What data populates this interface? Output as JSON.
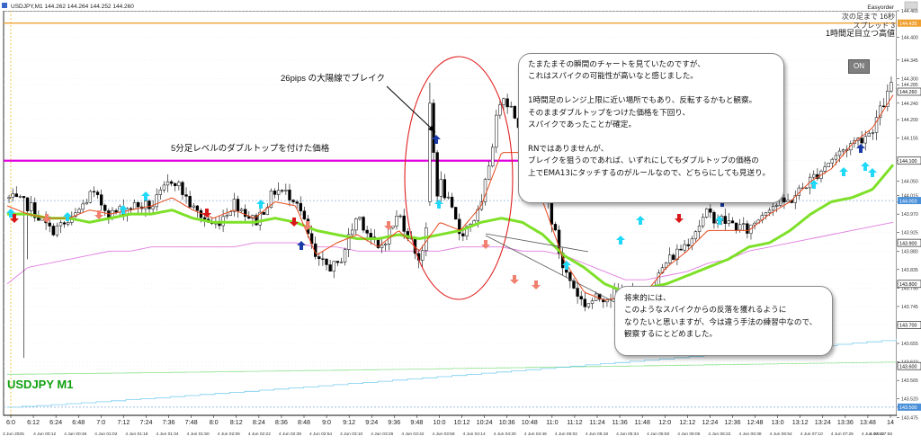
{
  "header": {
    "symbol_info": "USDJPY,M1  144.262 144.264 144.252 144.260",
    "broker": "Easyorder",
    "next_bar": "次の足まで 16秒",
    "spread": "スプレッド 3",
    "hourly_label": "1時間足目立つ高値"
  },
  "watermark": "USDJPY M1",
  "on_button": "ON",
  "annotations": {
    "breakout": "26pips の大陽線でブレイク",
    "double_top": "5分足レベルのダブルトップを付けた価格",
    "box1": [
      "たまたまその瞬間のチャートを見ていたのですが、",
      "これはスパイクの可能性が高いなと感じました。",
      "",
      "1時間足のレンジ上限に近い場所でもあり、反転するかもと観察。",
      "そのままダブルトップをつけた価格を下回り、",
      "スパイクであったことが確定。",
      "",
      "RNではありませんが、",
      "ブレイクを狙うのであれば、いずれにしてもダブルトップの価格の",
      "上でEMA13にタッチするのがルールなので、どちらにしても見送り。"
    ],
    "box2": [
      "将来的には、",
      "このようなスパイクからの反落を獲れるように",
      "なりたいと思いますが、今は違う手法の練習中なので、",
      "観察するにとどめました。"
    ]
  },
  "colors": {
    "ema_green": "#7ee028",
    "ema_red": "#e84a1f",
    "sma_magenta": "#e07de0",
    "magenta_line": "#e000e0",
    "orange_line": "#f0a030",
    "ellipse": "#e02020",
    "arrow_up": "#20d8f8",
    "arrow_blue": "#1a3aa8",
    "arrow_red": "#d81818",
    "arrow_salmon": "#f08070",
    "watermark": "#10a010"
  },
  "chart_data": {
    "type": "candlestick",
    "symbol": "USDJPY",
    "timeframe": "M1",
    "ylim": [
      143.48,
      144.465
    ],
    "y_ticks": [
      "144.465",
      "144.400",
      "144.345",
      "144.300",
      "144.285",
      "144.240",
      "144.200",
      "144.155",
      "144.100",
      "144.050",
      "144.015",
      "144.000",
      "143.970",
      "143.925",
      "143.900",
      "143.880",
      "143.835",
      "143.800",
      "143.790",
      "143.745",
      "143.700",
      "143.655",
      "143.610",
      "143.600",
      "143.565",
      "143.520",
      "143.500",
      "143.475"
    ],
    "price_labels": [
      {
        "value": 144.435,
        "text": "144.435",
        "bg": "#f0a030"
      },
      {
        "value": 144.268,
        "text": "144.260",
        "bg": "#ffffff"
      },
      {
        "value": 144.1,
        "text": "144.100",
        "bg": "#ffffff"
      },
      {
        "value": 144.003,
        "text": "144.003",
        "bg": "#4a90d9"
      },
      {
        "value": 143.9,
        "text": "143.900",
        "bg": "#ffffff"
      },
      {
        "value": 143.8,
        "text": "143.800",
        "bg": "#ffffff"
      },
      {
        "value": 143.7,
        "text": "143.700",
        "bg": "#ffffff"
      },
      {
        "value": 143.6,
        "text": "143.600",
        "bg": "#ffffff"
      },
      {
        "value": 143.5,
        "text": "143.500",
        "bg": "#4a90d9"
      }
    ],
    "x_ticks_top": [
      "6:0",
      "6:12",
      "6:24",
      "6:48",
      "7:0",
      "7:12",
      "7:24",
      "7:36",
      "7:48",
      "8:0",
      "8:12",
      "8:24",
      "8:36",
      "8:48",
      "9:0",
      "9:12",
      "9:24",
      "9:36",
      "9:48",
      "10:0",
      "10:12",
      "10:24",
      "10:36",
      "10:48",
      "11:0",
      "11:12",
      "11:24",
      "11:36",
      "11:48",
      "12:0",
      "12:12",
      "12:24",
      "12:36",
      "12:48",
      "13:0",
      "13:12",
      "13:24",
      "13:36",
      "13:48",
      "14"
    ],
    "x_ticks_bottom": [
      "3 Jun 2025",
      "4 Jun 00:12",
      "4 Jun 00:46",
      "4 Jun 01:02",
      "4 Jun 01:18",
      "4 Jun 01:34",
      "4 Jun 01:50",
      "4 Jun 02:06",
      "4 Jun 02:22",
      "4 Jun 02:38",
      "4 Jun 02:54",
      "4 Jun 03:10",
      "4 Jun 03:26",
      "4 Jun 03:42",
      "4 Jun 03:58",
      "4 Jun 04:14",
      "4 Jun 04:30",
      "4 Jun 04:46",
      "4 Jun 05:02",
      "4 Jun 05:18",
      "4 Jun 05:34",
      "4 Jun 05:50",
      "4 Jun 06:06",
      "4 Jun 06:22",
      "4 Jun 06:38",
      "4 Jun 06:54",
      "4 Jun 07:10",
      "4 Jun 07:26",
      "4 Jun 07:42",
      "4 Jun 07:58"
    ],
    "levels": [
      {
        "name": "1時間足目立つ高値",
        "value": 144.435,
        "color": "#f0a030"
      },
      {
        "name": "double-top",
        "value": 144.1,
        "color": "#e000e0"
      }
    ],
    "anchors": {
      "price": [
        144.008,
        143.99,
        143.93,
        143.95,
        144.02,
        143.97,
        143.99,
        143.99,
        144.06,
        143.98,
        143.94,
        144.0,
        143.95,
        144.03,
        144.01,
        143.85,
        143.84,
        143.97,
        143.88,
        143.97,
        143.86,
        144.05,
        143.92,
        143.98,
        144.27,
        144.18,
        144.05,
        143.84,
        143.75,
        143.77,
        143.78,
        143.76,
        143.85,
        143.9,
        143.97,
        143.95,
        143.93,
        143.99,
        144.0,
        144.05,
        144.1,
        144.14,
        144.17,
        144.28
      ],
      "ema13": [
        143.99,
        143.97,
        143.96,
        143.96,
        143.98,
        143.97,
        143.98,
        143.99,
        144.01,
        143.98,
        143.96,
        143.98,
        143.96,
        144.0,
        143.99,
        143.87,
        143.9,
        143.92,
        143.89,
        143.93,
        143.88,
        143.95,
        143.93,
        143.99,
        144.12,
        144.12,
        144.0,
        143.86,
        143.78,
        143.76,
        143.77,
        143.78,
        143.84,
        143.88,
        143.93,
        143.93,
        143.93,
        143.97,
        144.0,
        144.05,
        144.08,
        144.14,
        144.18,
        144.26
      ],
      "ema_green": [
        143.97,
        143.97,
        143.96,
        143.96,
        143.95,
        143.96,
        143.97,
        143.97,
        143.98,
        143.96,
        143.95,
        143.95,
        143.95,
        143.96,
        143.95,
        143.93,
        143.92,
        143.91,
        143.91,
        143.92,
        143.91,
        143.92,
        143.93,
        143.95,
        143.96,
        143.95,
        143.92,
        143.87,
        143.84,
        143.8,
        143.78,
        143.79,
        143.8,
        143.82,
        143.84,
        143.86,
        143.89,
        143.9,
        143.93,
        143.97,
        144.0,
        144.01,
        144.03,
        144.09
      ],
      "sma_pink": [
        143.8,
        143.84,
        143.85,
        143.86,
        143.87,
        143.88,
        143.88,
        143.89,
        143.89,
        143.89,
        143.89,
        143.89,
        143.9,
        143.9,
        143.9,
        143.89,
        143.89,
        143.88,
        143.88,
        143.88,
        143.88,
        143.88,
        143.89,
        143.89,
        143.89,
        143.88,
        143.88,
        143.87,
        143.85,
        143.83,
        143.81,
        143.81,
        143.82,
        143.83,
        143.85,
        143.86,
        143.88,
        143.89,
        143.9,
        143.91,
        143.92,
        143.93,
        143.94,
        143.95
      ],
      "band_green": [
        143.58,
        143.61
      ],
      "band_blue": [
        143.5,
        143.665
      ],
      "spike": {
        "high": 144.29,
        "low": 143.96
      }
    }
  }
}
